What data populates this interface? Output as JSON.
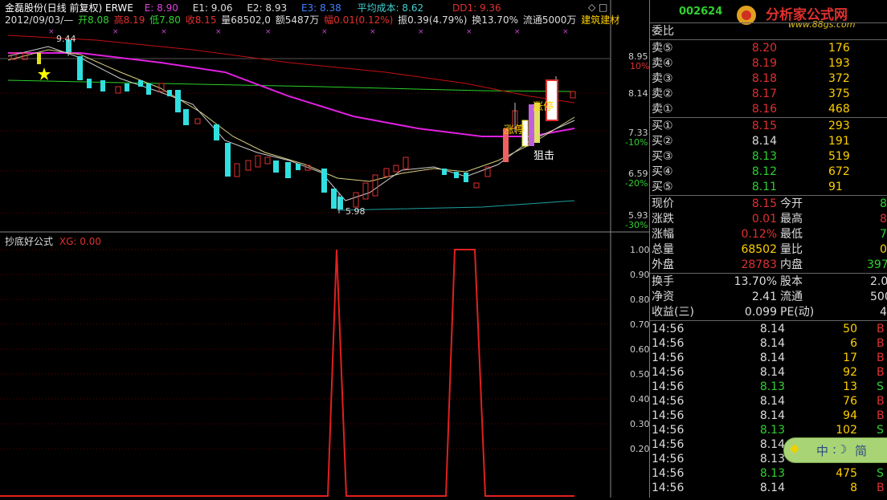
{
  "header": {
    "stock_title": "金磊股份(日线 前复权) ERWE",
    "e_label": "E: 8.90",
    "e1_label": "E1: 9.06",
    "e2_label": "E2: 8.93",
    "e3_label": "E3: 8.38",
    "avg_cost_label": "平均成本: 8.62",
    "dd1_label": "DD1: 9.36",
    "date_range": "2012/09/03/—",
    "open": "开8.08",
    "high": "高8.19",
    "low": "低7.80",
    "close": "收8.15",
    "volume": "量68502,0",
    "amount": "额5487万",
    "change_pct": "幅0.01(0.12%)",
    "amplitude": "振0.39(4.79%)",
    "turnover": "换13.70%",
    "float_shares": "流通5000万",
    "sector": "建筑建材"
  },
  "main_chart": {
    "price_axis": [
      {
        "value": "8.95"
      },
      {
        "value": "10%"
      },
      {
        "value": "8.14"
      },
      {
        "value": "7.33"
      },
      {
        "value": "-10%"
      },
      {
        "value": "6.59"
      },
      {
        "value": "-20%"
      },
      {
        "value": "5.93"
      },
      {
        "value": "-30%"
      }
    ],
    "high_marker": "9.44",
    "low_marker": "5.98",
    "annotation_zhangting": "涨停",
    "annotation_zhangting2": "涨停",
    "annotation_juji": "狙击"
  },
  "indicator": {
    "name": "抄底好公式",
    "xg_label": "XG: 0.00",
    "axis": [
      "1.00",
      "0.90",
      "0.80",
      "0.70",
      "0.60",
      "0.50",
      "0.40",
      "0.30",
      "0.20"
    ]
  },
  "right_panel": {
    "code": "002624",
    "watermark": "分析家公式网",
    "watermark_url": "www.88gs.com",
    "weibi_label": "委比",
    "asks": [
      {
        "label": "卖⑤",
        "price": "8.20",
        "vol": "176"
      },
      {
        "label": "卖④",
        "price": "8.19",
        "vol": "193"
      },
      {
        "label": "卖③",
        "price": "8.18",
        "vol": "372"
      },
      {
        "label": "卖②",
        "price": "8.17",
        "vol": "375"
      },
      {
        "label": "卖①",
        "price": "8.16",
        "vol": "468"
      }
    ],
    "bids": [
      {
        "label": "买①",
        "price": "8.15",
        "vol": "293"
      },
      {
        "label": "买②",
        "price": "8.14",
        "vol": "191"
      },
      {
        "label": "买③",
        "price": "8.13",
        "vol": "519"
      },
      {
        "label": "买④",
        "price": "8.12",
        "vol": "672"
      },
      {
        "label": "买⑤",
        "price": "8.11",
        "vol": "91"
      }
    ],
    "stats": [
      {
        "l1": "现价",
        "v1": "8.15",
        "l2": "今开",
        "v2": "8"
      },
      {
        "l1": "涨跌",
        "v1": "0.01",
        "l2": "最高",
        "v2": "8"
      },
      {
        "l1": "涨幅",
        "v1": "0.12%",
        "l2": "最低",
        "v2": "7"
      },
      {
        "l1": "总量",
        "v1": "68502",
        "l2": "量比",
        "v2": "0"
      },
      {
        "l1": "外盘",
        "v1": "28783",
        "l2": "内盘",
        "v2": "397"
      }
    ],
    "stats2": [
      {
        "l1": "换手",
        "v1": "13.70%",
        "l2": "股本",
        "v2": "2.0"
      },
      {
        "l1": "净资",
        "v1": "2.41",
        "l2": "流通",
        "v2": "500"
      },
      {
        "l1": "收益(三)",
        "v1": "0.099",
        "l2": "PE(动)",
        "v2": "4"
      }
    ],
    "ticks": [
      {
        "t": "14:56",
        "p": "8.14",
        "v": "50",
        "s": "B"
      },
      {
        "t": "14:56",
        "p": "8.14",
        "v": "6",
        "s": "B"
      },
      {
        "t": "14:56",
        "p": "8.14",
        "v": "17",
        "s": "B"
      },
      {
        "t": "14:56",
        "p": "8.14",
        "v": "92",
        "s": "B"
      },
      {
        "t": "14:56",
        "p": "8.13",
        "v": "13",
        "s": "S"
      },
      {
        "t": "14:56",
        "p": "8.14",
        "v": "76",
        "s": "B"
      },
      {
        "t": "14:56",
        "p": "8.14",
        "v": "94",
        "s": "B"
      },
      {
        "t": "14:56",
        "p": "8.13",
        "v": "102",
        "s": "S"
      },
      {
        "t": "14:56",
        "p": "8.14",
        "v": "",
        "s": ""
      },
      {
        "t": "14:56",
        "p": "8.13",
        "v": "",
        "s": ""
      },
      {
        "t": "14:56",
        "p": "8.13",
        "v": "475",
        "s": "S"
      },
      {
        "t": "14:56",
        "p": "8.14",
        "v": "8",
        "s": "B"
      }
    ],
    "switch_label_cn": "中",
    "switch_label_jian": "简"
  }
}
